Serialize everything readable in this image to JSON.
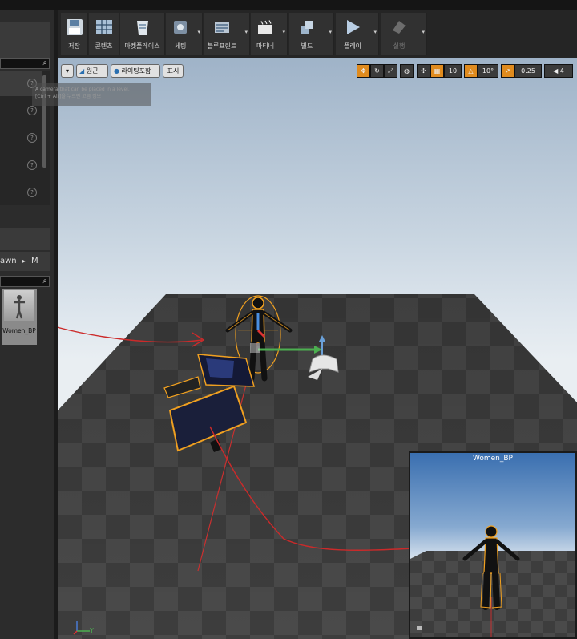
{
  "left_panel": {
    "tooltip_line1": "A camera that can be placed in a level.",
    "tooltip_line2": "[Ctrl + Alt]을 누르면 고급 정보",
    "breadcrumb_current": "awn",
    "breadcrumb_next": "M",
    "asset_name": "Women_BP"
  },
  "toolbar": {
    "buttons": [
      {
        "label": "저장",
        "icon": "save-icon"
      },
      {
        "label": "콘텐츠",
        "icon": "content-browser-icon"
      },
      {
        "label": "마켓플레이스",
        "icon": "marketplace-icon"
      },
      {
        "label": "세팅",
        "icon": "settings-icon"
      },
      {
        "label": "블루프린트",
        "icon": "blueprint-icon"
      },
      {
        "label": "마티네",
        "icon": "matinee-icon"
      },
      {
        "label": "빌드",
        "icon": "build-icon"
      },
      {
        "label": "플레이",
        "icon": "play-icon"
      },
      {
        "label": "실행",
        "icon": "launch-icon"
      }
    ]
  },
  "viewport": {
    "perspective_label": "원근",
    "lighting_label": "라이팅포함",
    "show_label": "표시",
    "grid_snap": "10",
    "rotation_snap": "10°",
    "scale_snap": "0.25",
    "camera_speed": "4",
    "pip_title": "Women_BP",
    "axis_label": "Y"
  },
  "colors": {
    "selection": "#f0a020",
    "arrow": "#cc2a2a",
    "accent": "#e08b1e"
  }
}
